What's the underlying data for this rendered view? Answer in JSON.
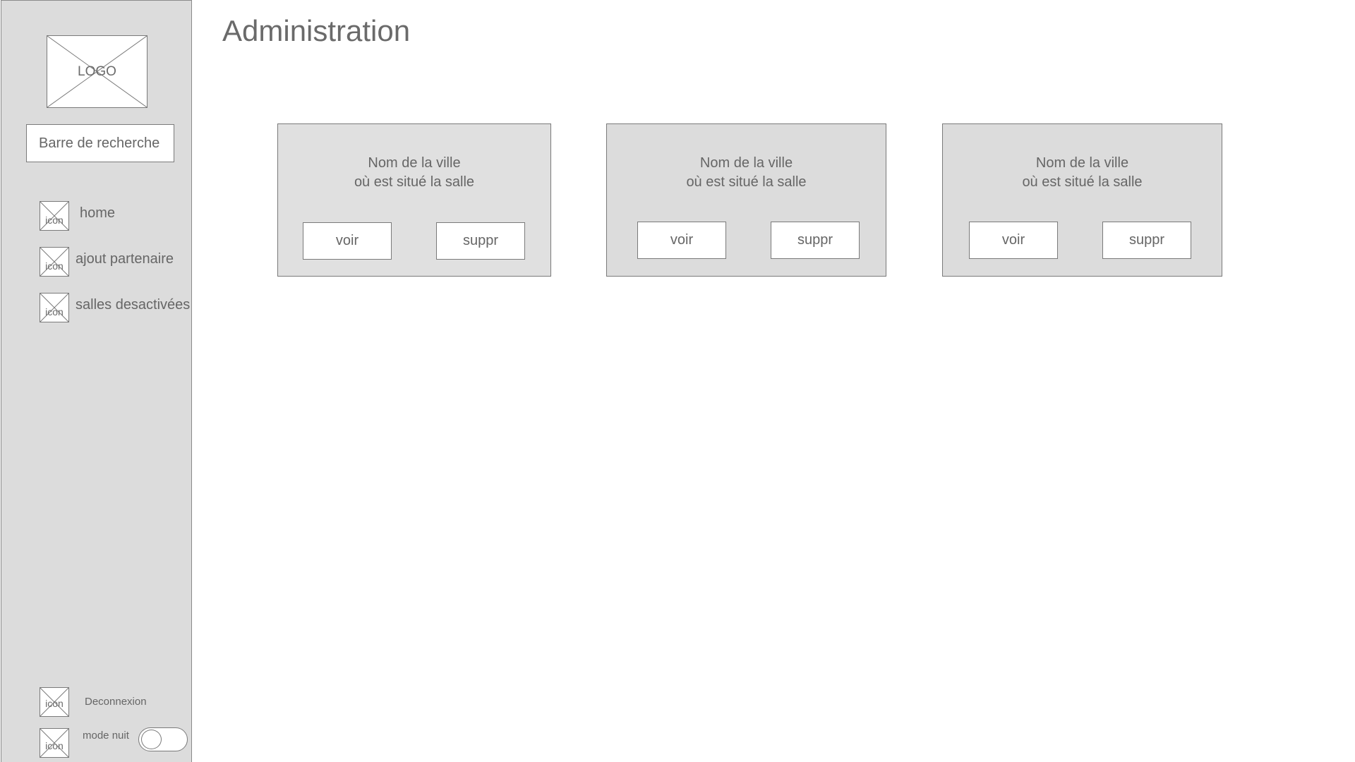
{
  "sidebar": {
    "logo_text": "LOGO",
    "search_placeholder": "Barre de recherche",
    "icon_placeholder_text": "icon",
    "nav_items": [
      {
        "label": "home",
        "icon": "home-icon"
      },
      {
        "label": "ajout partenaire",
        "icon": "add-partner-icon"
      },
      {
        "label": "salles desactivées",
        "icon": "disabled-rooms-icon"
      }
    ],
    "logout_label": "Deconnexion",
    "night_mode_label": "mode nuit",
    "night_mode_on": false
  },
  "main": {
    "title": "Administration",
    "cards": [
      {
        "title_line1": "Nom de la ville",
        "title_line2": "où est situé la salle",
        "view_label": "voir",
        "delete_label": "suppr"
      },
      {
        "title_line1": "Nom de la ville",
        "title_line2": "où est situé la salle",
        "view_label": "voir",
        "delete_label": "suppr"
      },
      {
        "title_line1": "Nom de la ville",
        "title_line2": "où est situé la salle",
        "view_label": "voir",
        "delete_label": "suppr"
      }
    ]
  },
  "colors": {
    "sidebar_bg": "#dcdcdc",
    "card_bg": "#dcdcdc",
    "border": "#7a7a7a",
    "text": "#666666"
  }
}
